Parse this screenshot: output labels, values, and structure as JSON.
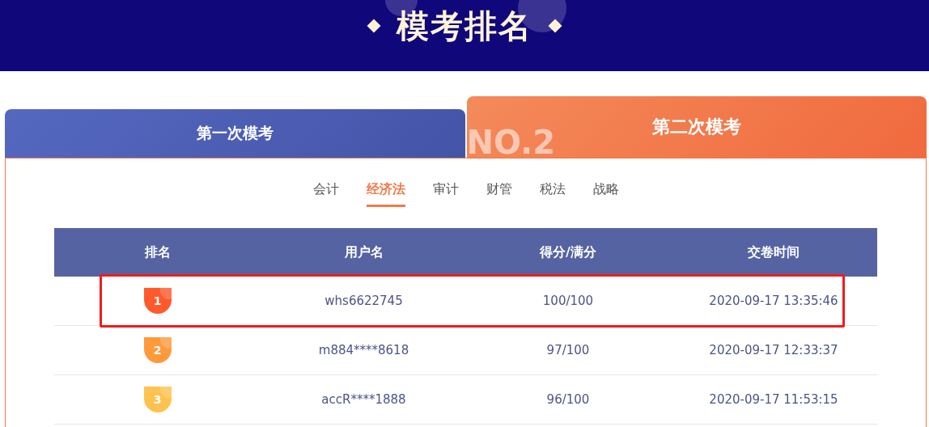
{
  "banner": {
    "title": "模考排名"
  },
  "exam_tabs": [
    {
      "label": "第一次模考",
      "selected": false
    },
    {
      "label": "第二次模考",
      "selected": true,
      "decoration": "NO.2"
    }
  ],
  "subject_tabs": [
    {
      "label": "会计",
      "selected": false
    },
    {
      "label": "经济法",
      "selected": true
    },
    {
      "label": "审计",
      "selected": false
    },
    {
      "label": "财管",
      "selected": false
    },
    {
      "label": "税法",
      "selected": false
    },
    {
      "label": "战略",
      "selected": false
    }
  ],
  "table": {
    "columns": [
      "排名",
      "用户名",
      "得分/满分",
      "交卷时间"
    ],
    "rows": [
      {
        "rank": "1",
        "color": "#ff5a2c",
        "user": "whs6622745",
        "score": "100/100",
        "time": "2020-09-17 13:35:46",
        "highlighted": true
      },
      {
        "rank": "2",
        "color": "#ff9a3c",
        "user": "m884****8618",
        "score": "97/100",
        "time": "2020-09-17 12:33:37",
        "highlighted": false
      },
      {
        "rank": "3",
        "color": "#ffc24f",
        "user": "accR****1888",
        "score": "96/100",
        "time": "2020-09-17 11:53:15",
        "highlighted": false
      }
    ]
  }
}
